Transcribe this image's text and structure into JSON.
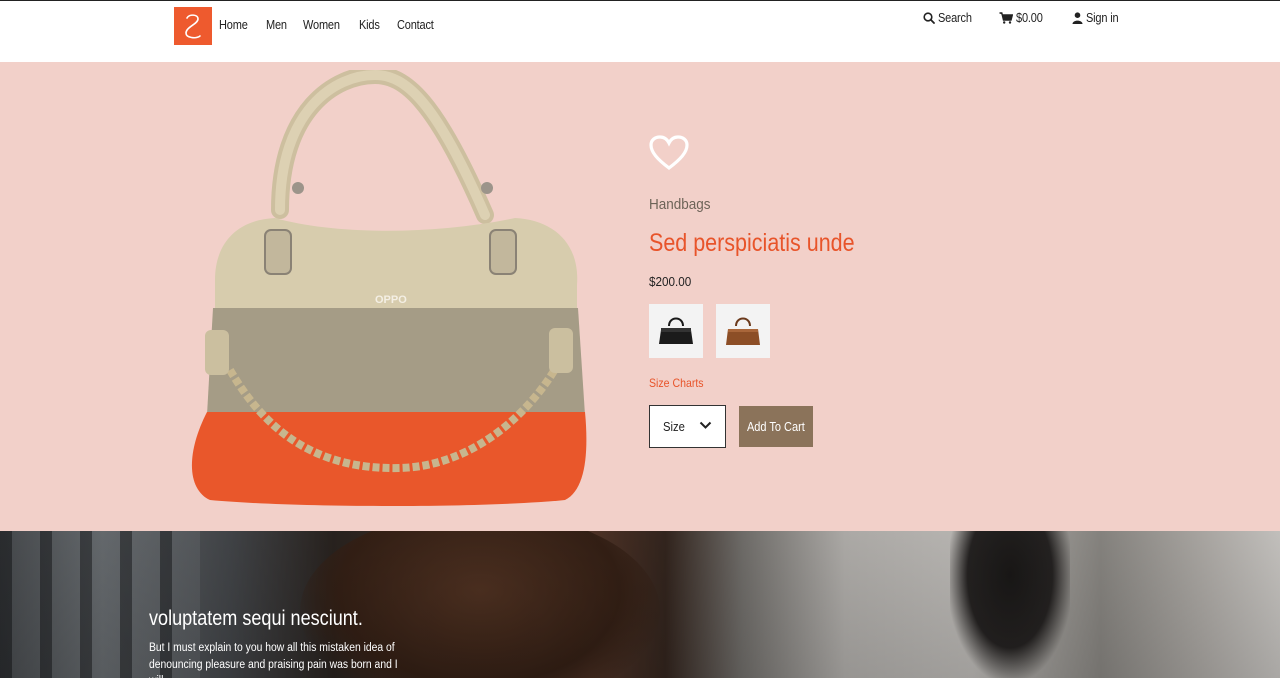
{
  "header": {
    "nav": [
      "Home",
      "Men",
      "Women",
      "Kids",
      "Contact"
    ],
    "search_label": "Search",
    "cart_label": "$0.00",
    "signin_label": "Sign in"
  },
  "product": {
    "category": "Handbags",
    "title": "Sed perspiciatis unde",
    "price": "$200.00",
    "size_chart_label": "Size Charts",
    "size_select_value": "Size",
    "add_to_cart_label": "Add To Cart"
  },
  "banner": {
    "title": "voluptatem sequi nesciunt.",
    "text": "But I must explain to you how all this mistaken idea of denouncing pleasure and praising pain was born and I will"
  },
  "colors": {
    "accent": "#e8542a",
    "logo": "#ee5a2e",
    "hero_bg": "#f2d0c9",
    "button": "#8b735a"
  }
}
